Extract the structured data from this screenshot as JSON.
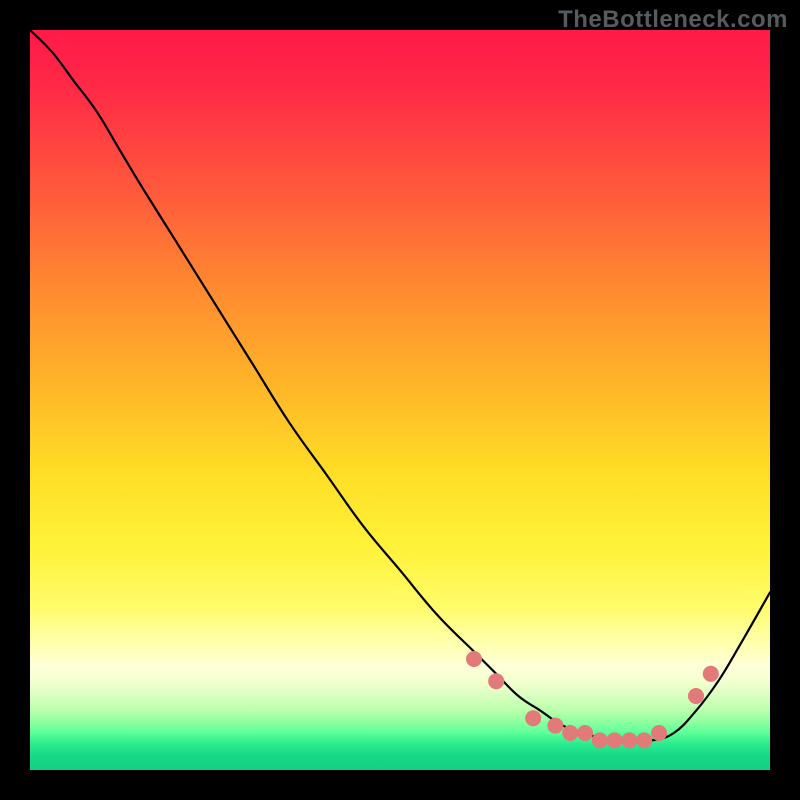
{
  "watermark": "TheBottleneck.com",
  "chart_data": {
    "type": "line",
    "title": "",
    "xlabel": "",
    "ylabel": "",
    "xlim": [
      0,
      100
    ],
    "ylim": [
      0,
      100
    ],
    "grid": false,
    "background_gradient": {
      "stops": [
        {
          "pos": 0,
          "color": "#ff1a48"
        },
        {
          "pos": 35,
          "color": "#ff8a30"
        },
        {
          "pos": 60,
          "color": "#ffde26"
        },
        {
          "pos": 85,
          "color": "#ffffd0"
        },
        {
          "pos": 100,
          "color": "#14cf84"
        }
      ]
    },
    "series": [
      {
        "name": "bottleneck-curve",
        "x": [
          0,
          3,
          6,
          9,
          12,
          15,
          20,
          25,
          30,
          35,
          40,
          45,
          50,
          55,
          60,
          63,
          66,
          69,
          72,
          75,
          78,
          81,
          84,
          87,
          90,
          93,
          96,
          100
        ],
        "y": [
          100,
          97,
          93,
          89,
          84,
          79,
          71,
          63,
          55,
          47,
          40,
          33,
          27,
          21,
          16,
          13,
          10,
          8,
          6,
          5,
          4,
          4,
          4,
          5,
          8,
          12,
          17,
          24
        ]
      }
    ],
    "markers": {
      "name": "highlight-points",
      "color": "#e17a78",
      "radius_px": 8,
      "x": [
        60,
        63,
        68,
        71,
        73,
        75,
        77,
        79,
        81,
        83,
        85,
        90,
        92
      ],
      "y": [
        15,
        12,
        7,
        6,
        5,
        5,
        4,
        4,
        4,
        4,
        5,
        10,
        13
      ]
    }
  }
}
